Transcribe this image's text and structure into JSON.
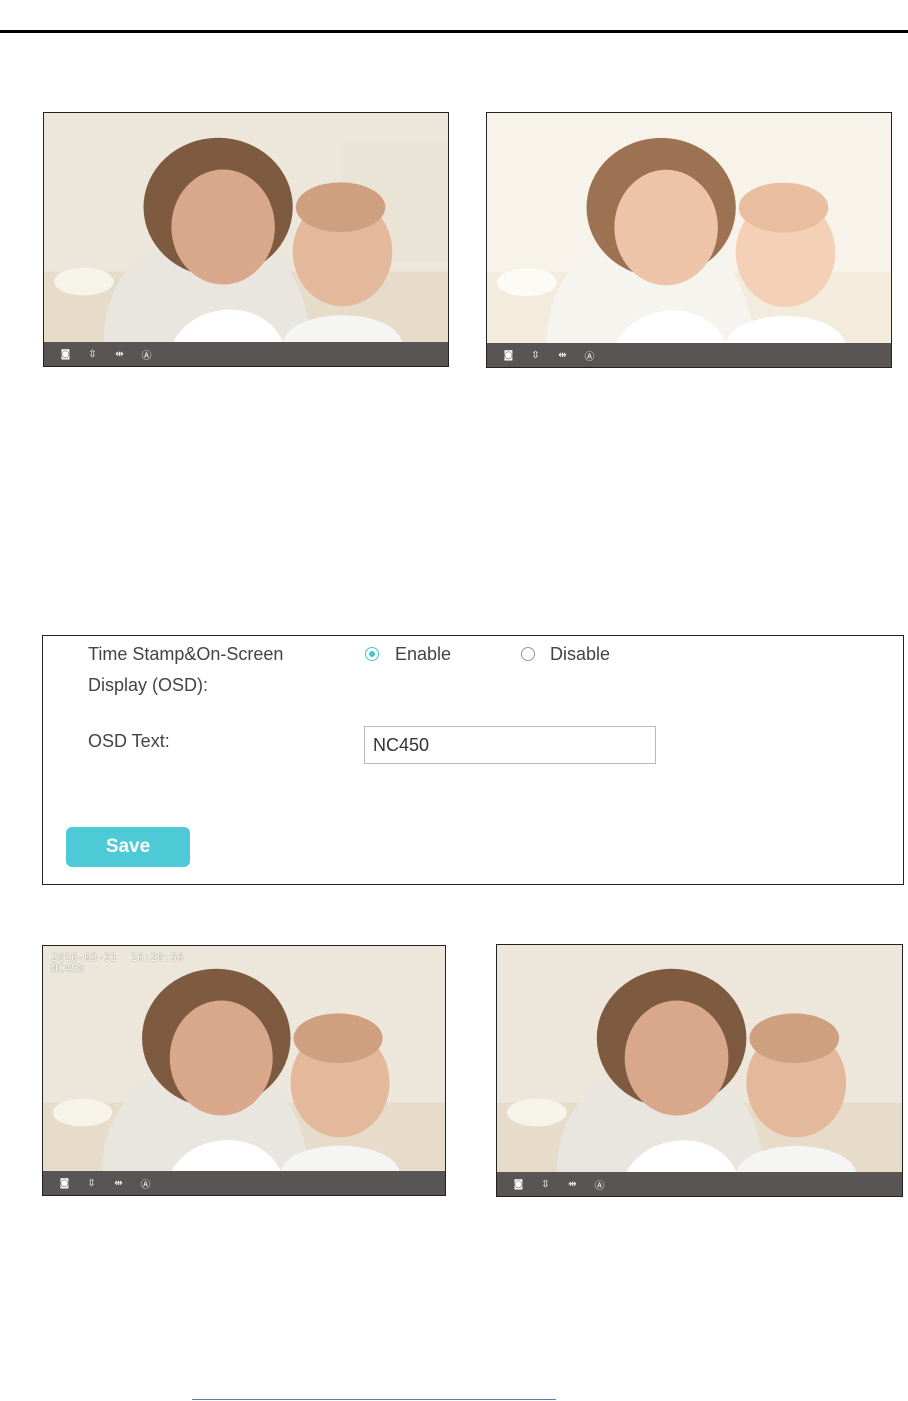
{
  "camera_toolbar": {
    "snapshot_icon": "camera-icon",
    "vflip_icon": "vertical-flip-icon",
    "hflip_icon": "horizontal-flip-icon",
    "auto_icon": "auto-mode-icon"
  },
  "osd_preview": {
    "timestamp": "2016-03-31  16:20:56",
    "text": "NC450"
  },
  "settings": {
    "osd_label_line1": "Time Stamp&On-Screen",
    "osd_label_line2": "Display (OSD):",
    "enable_label": "Enable",
    "disable_label": "Disable",
    "selected": "Enable",
    "osd_text_label": "OSD Text:",
    "osd_text_value": "NC450",
    "save_label": "Save"
  },
  "colors": {
    "accent": "#4ec9d6",
    "toolbar": "#5a5555"
  }
}
